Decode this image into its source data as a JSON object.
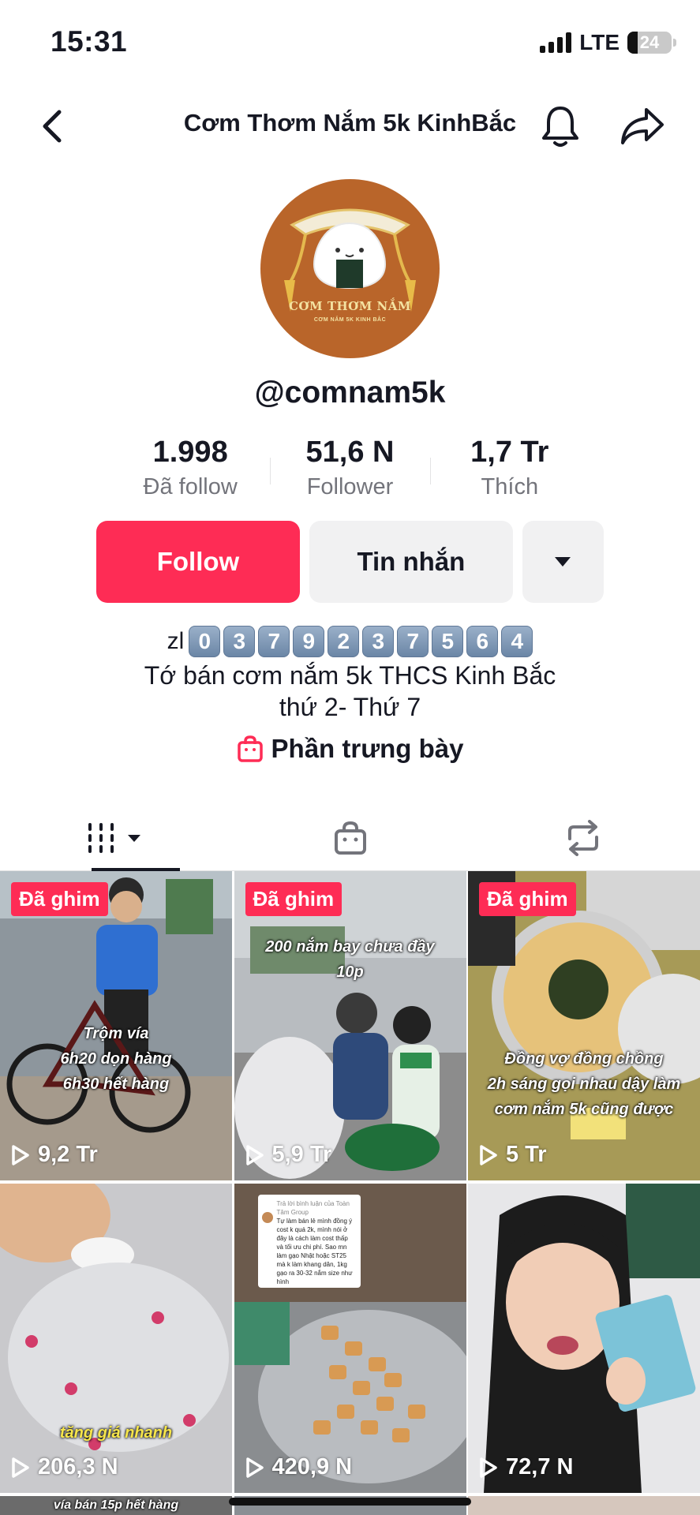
{
  "status_bar": {
    "time": "15:31",
    "network": "LTE",
    "battery": "24"
  },
  "nav": {
    "title": "Cơm Thơm Nắm 5k KinhBắc"
  },
  "profile": {
    "avatar_text": "CƠM THƠM NẮM",
    "avatar_subtext": "CƠM NẮM 5K KINH BẮC",
    "username": "@comnam5k"
  },
  "stats": [
    {
      "value": "1.998",
      "label": "Đã follow"
    },
    {
      "value": "51,6 N",
      "label": "Follower"
    },
    {
      "value": "1,7 Tr",
      "label": "Thích"
    }
  ],
  "actions": {
    "follow": "Follow",
    "message": "Tin nhắn"
  },
  "bio": {
    "prefix": "zl",
    "digits": [
      "0",
      "3",
      "7",
      "9",
      "2",
      "3",
      "7",
      "5",
      "6",
      "4"
    ],
    "line1": "Tớ bán cơm nắm 5k THCS Kinh Bắc",
    "line2": "thứ 2- Thứ 7"
  },
  "showcase": {
    "label": "Phần trưng bày"
  },
  "videos": [
    {
      "pinned_label": "Đã ghim",
      "caption_lines": [
        "Trộm vía",
        "6h20 dọn hàng",
        "6h30 hết hàng"
      ],
      "views": "9,2 Tr"
    },
    {
      "pinned_label": "Đã ghim",
      "caption_lines": [
        "200 nắm bay chưa đầy 10p"
      ],
      "views": "5,9 Tr"
    },
    {
      "pinned_label": "Đã ghim",
      "caption_lines": [
        "Đồng vợ đồng chồng",
        "2h sáng gọi nhau dậy làm",
        "cơm nắm 5k cũng được"
      ],
      "views": "5 Tr"
    },
    {
      "caption_lines": [
        "tăng giá nhanh"
      ],
      "views": "206,3 N"
    },
    {
      "note_header": "Trả lời bình luận của Toàn Tâm Group",
      "note_body": "Tự làm bán lẻ mình đồng ý cost k quá 2k, mình nói ở đây là cách làm cost thấp và tối ưu chi phí. Sao mn làm gạo Nhật hoặc ST25 mà k làm khang dân, 1kg gạo ra 30-32 nắm size như hình",
      "views": "420,9 N"
    },
    {
      "views": "72,7 N"
    }
  ],
  "partial_row": {
    "left_caption": "vía bán 15p hết hàng"
  },
  "colors": {
    "accent": "#fe2c55",
    "avatar_bg": "#b9652a"
  }
}
